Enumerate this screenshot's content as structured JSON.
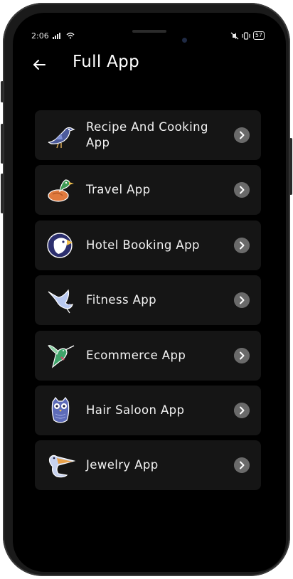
{
  "status_bar": {
    "time": "2:06",
    "battery": "57"
  },
  "header": {
    "title": "Full App"
  },
  "items": [
    {
      "label": "Recipe And Cooking App",
      "icon": "bird-icon"
    },
    {
      "label": "Travel App",
      "icon": "duck-icon"
    },
    {
      "label": "Hotel Booking App",
      "icon": "eagle-icon"
    },
    {
      "label": "Fitness App",
      "icon": "dove-icon"
    },
    {
      "label": "Ecommerce App",
      "icon": "hummingbird-icon"
    },
    {
      "label": "Hair Saloon App",
      "icon": "owl-icon"
    },
    {
      "label": "Jewelry App",
      "icon": "pelican-icon"
    }
  ],
  "colors": {
    "background": "#000000",
    "card": "#151515",
    "chevron": "#6a6a6a",
    "text": "#f2f2f2"
  }
}
